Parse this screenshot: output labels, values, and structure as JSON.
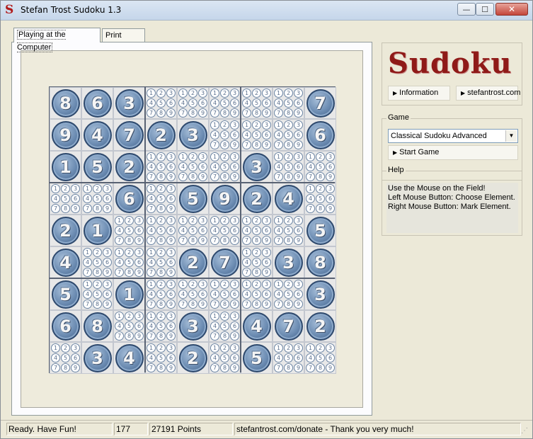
{
  "window": {
    "title": "Stefan Trost Sudoku 1.3",
    "app_icon": "S",
    "min_label": "—",
    "max_label": "☐",
    "close_label": "✕"
  },
  "tabs": [
    {
      "label": "Playing at the Computer",
      "active": true
    },
    {
      "label": "Print Mode",
      "active": false
    }
  ],
  "board": {
    "givens": [
      "863.....7",
      "94723...6",
      "152...3..",
      "..6.5924.",
      "21......5",
      "4...27.38",
      "5.1.....3",
      "68..3.472",
      ".34.2.5..."
    ],
    "candidate_digits": [
      "1",
      "2",
      "3",
      "4",
      "5",
      "6",
      "7",
      "8",
      "9"
    ]
  },
  "logo": {
    "text": "Sudoku"
  },
  "links": {
    "information": "Information",
    "website": "stefantrost.com"
  },
  "game": {
    "legend": "Game",
    "mode": "Classical Sudoku Advanced",
    "start_label": "Start Game"
  },
  "help": {
    "legend": "Help",
    "lines": [
      "Use the Mouse on the Field!",
      "Left Mouse Button: Choose Element.",
      "Right Mouse Button: Mark Element."
    ]
  },
  "status": {
    "message": "Ready. Have Fun!",
    "count": "177",
    "points": "27191 Points",
    "donate": "stefantrost.com/donate - Thank you very much!"
  },
  "colors": {
    "logo": "#8f1a18",
    "ball": "#6d8db3"
  }
}
